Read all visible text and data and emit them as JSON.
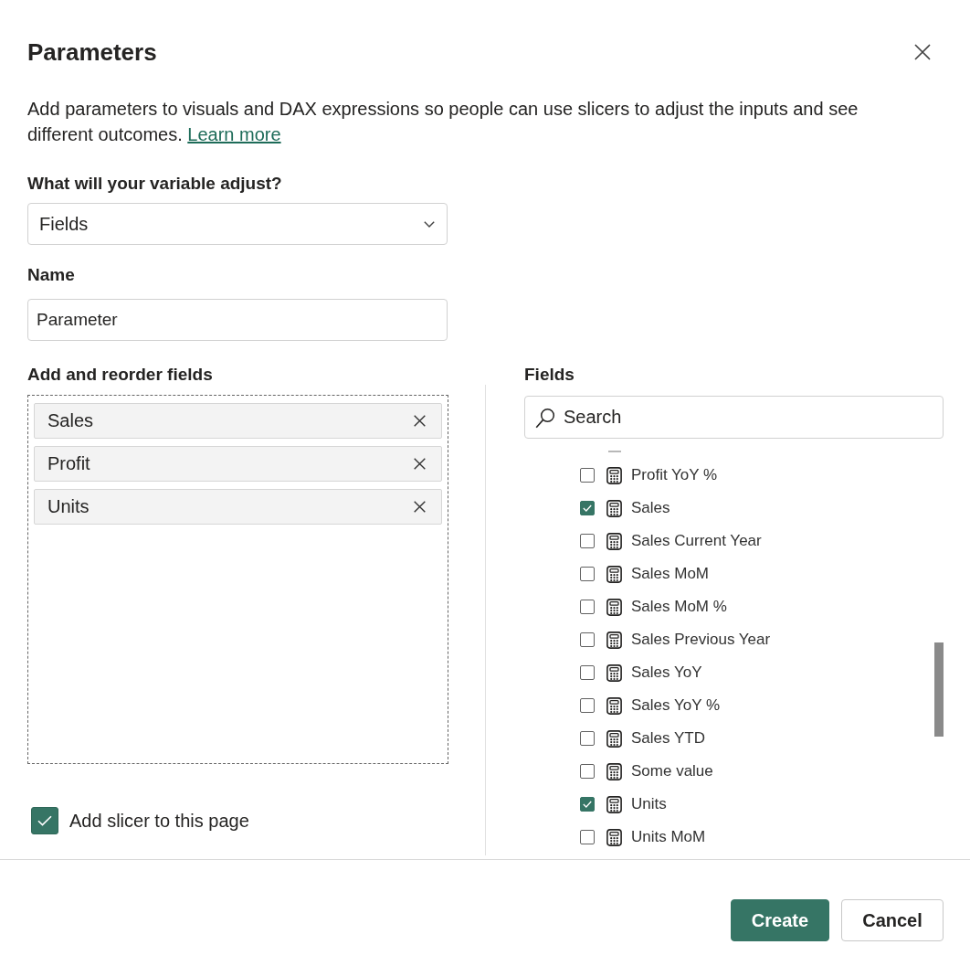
{
  "dialog": {
    "title": "Parameters",
    "description": "Add parameters to visuals and DAX expressions so people can use slicers to adjust the inputs and see different outcomes.",
    "link": "Learn more"
  },
  "variable": {
    "label": "What will your variable adjust?",
    "value": "Fields"
  },
  "name": {
    "label": "Name",
    "value": "Parameter"
  },
  "selected_fields": {
    "label": "Add and reorder fields",
    "items": [
      "Sales",
      "Profit",
      "Units"
    ]
  },
  "add_slicer": {
    "label": "Add slicer to this page",
    "checked": true
  },
  "field_list": {
    "label": "Fields",
    "search": {
      "placeholder": "Search"
    },
    "items": [
      {
        "name": "Profit YoY %",
        "checked": false
      },
      {
        "name": "Sales",
        "checked": true
      },
      {
        "name": "Sales Current Year",
        "checked": false
      },
      {
        "name": "Sales MoM",
        "checked": false
      },
      {
        "name": "Sales MoM %",
        "checked": false
      },
      {
        "name": "Sales Previous Year",
        "checked": false
      },
      {
        "name": "Sales YoY",
        "checked": false
      },
      {
        "name": "Sales YoY %",
        "checked": false
      },
      {
        "name": "Sales YTD",
        "checked": false
      },
      {
        "name": "Some value",
        "checked": false
      },
      {
        "name": "Units",
        "checked": true
      },
      {
        "name": "Units MoM",
        "checked": false
      }
    ]
  },
  "buttons": [
    {
      "label": "Create",
      "kind": "primary"
    },
    {
      "label": "Cancel",
      "kind": "secondary"
    }
  ]
}
